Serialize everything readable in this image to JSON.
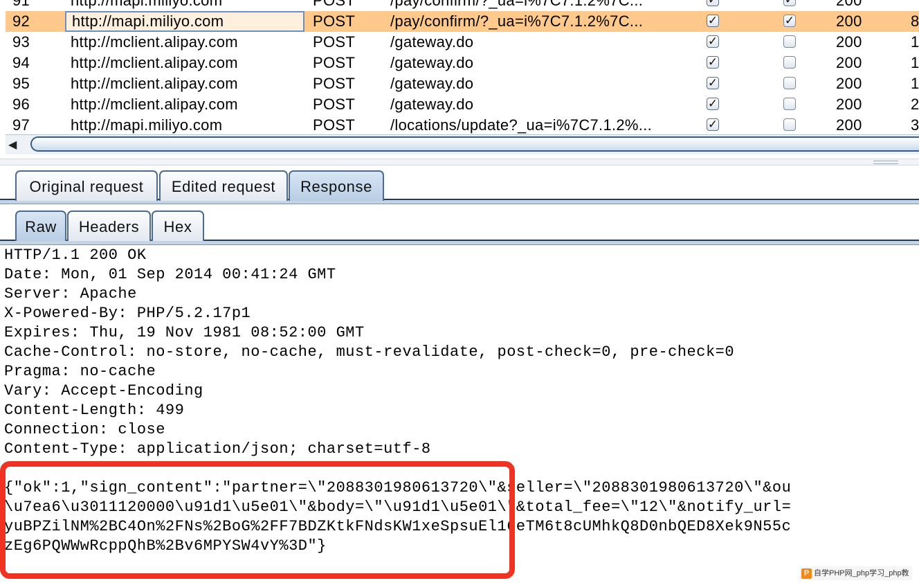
{
  "history": {
    "rows": [
      {
        "num": "91",
        "host": "http://mapi.miliyo.com",
        "method": "POST",
        "url": "/pay/confirm/?_ua=i%7C7.1.2%7C...",
        "mod1": true,
        "mod2": true,
        "status": "200",
        "extra": "",
        "selected": false
      },
      {
        "num": "92",
        "host": "http://mapi.miliyo.com",
        "method": "POST",
        "url": "/pay/confirm/?_ua=i%7C7.1.2%7C...",
        "mod1": true,
        "mod2": true,
        "status": "200",
        "extra": "8",
        "selected": true
      },
      {
        "num": "93",
        "host": "http://mclient.alipay.com",
        "method": "POST",
        "url": "/gateway.do",
        "mod1": true,
        "mod2": false,
        "status": "200",
        "extra": "1",
        "selected": false
      },
      {
        "num": "94",
        "host": "http://mclient.alipay.com",
        "method": "POST",
        "url": "/gateway.do",
        "mod1": true,
        "mod2": false,
        "status": "200",
        "extra": "1",
        "selected": false
      },
      {
        "num": "95",
        "host": "http://mclient.alipay.com",
        "method": "POST",
        "url": "/gateway.do",
        "mod1": true,
        "mod2": false,
        "status": "200",
        "extra": "1",
        "selected": false
      },
      {
        "num": "96",
        "host": "http://mclient.alipay.com",
        "method": "POST",
        "url": "/gateway.do",
        "mod1": true,
        "mod2": false,
        "status": "200",
        "extra": "2",
        "selected": false
      },
      {
        "num": "97",
        "host": "http://mapi.miliyo.com",
        "method": "POST",
        "url": "/locations/update?_ua=i%7C7.1.2%...",
        "mod1": true,
        "mod2": false,
        "status": "200",
        "extra": "3",
        "selected": false
      }
    ],
    "scroll_left_icon": "left-arrow-icon"
  },
  "main_tabs": {
    "original": "Original request",
    "edited": "Edited request",
    "response": "Response",
    "active": "response"
  },
  "sub_tabs": {
    "raw": "Raw",
    "headers": "Headers",
    "hex": "Hex",
    "active": "raw"
  },
  "response": {
    "headers": [
      "HTTP/1.1 200 OK",
      "Date: Mon, 01 Sep 2014 00:41:24 GMT",
      "Server: Apache",
      "X-Powered-By: PHP/5.2.17p1",
      "Expires: Thu, 19 Nov 1981 08:52:00 GMT",
      "Cache-Control: no-store, no-cache, must-revalidate, post-check=0, pre-check=0",
      "Pragma: no-cache",
      "Vary: Accept-Encoding",
      "Content-Length: 499",
      "Connection: close",
      "Content-Type: application/json; charset=utf-8"
    ],
    "body": [
      "{\"ok\":1,\"sign_content\":\"partner=\\\"2088301980613720\\\"&seller=\\\"2088301980613720\\\"&ou",
      "\\u7ea6\\u3011120000\\u91d1\\u5e01\\\"&body=\\\"\\u91d1\\u5e01\\\"&total_fee=\\\"12\\\"&notify_url=",
      "yuBPZilNM%2BC4On%2FNs%2BoG%2FF7BDZKtkFNdsKW1xeSpsuEl16eTM6t8cUMhkQ8D0nbQED8Xek9N55c",
      "zEg6PQWWwRcppQhB%2Bv6MPYSW4vY%3D\"}"
    ]
  },
  "annotation_color": "#f03222",
  "selected_row_color": "#ffc98b",
  "watermark": {
    "logo": "P",
    "text": "自学PHP网_php学习_php教"
  }
}
